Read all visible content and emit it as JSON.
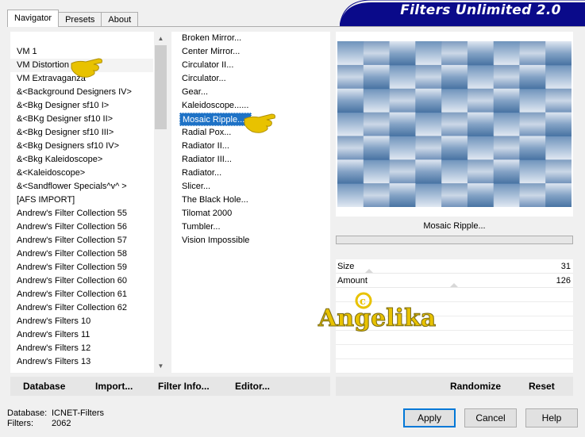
{
  "tabs": [
    "Navigator",
    "Presets",
    "About"
  ],
  "app_title": "Filters Unlimited 2.0",
  "categories": [
    "VM 1",
    "VM Distortion",
    "VM Extravaganza",
    "&<Background Designers IV>",
    "&<Bkg Designer sf10 I>",
    "&<BKg Designer sf10 II>",
    "&<Bkg Designer sf10 III>",
    "&<Bkg Designers sf10 IV>",
    "&<Bkg Kaleidoscope>",
    "&<Kaleidoscope>",
    "&<Sandflower Specials^v^ >",
    "[AFS IMPORT]",
    "Andrew's Filter Collection 55",
    "Andrew's Filter Collection 56",
    "Andrew's Filter Collection 57",
    "Andrew's Filter Collection 58",
    "Andrew's Filter Collection 59",
    "Andrew's Filter Collection 60",
    "Andrew's Filter Collection 61",
    "Andrew's Filter Collection 62",
    "Andrew's Filters 10",
    "Andrew's Filters 11",
    "Andrew's Filters 12",
    "Andrew's Filters 13"
  ],
  "selected_category": "VM Distortion",
  "filters": [
    "Broken Mirror...",
    "Center Mirror...",
    "Circulator II...",
    "Circulator...",
    "Gear...",
    "Kaleidoscope......",
    "Mosaic Ripple...",
    "Radial Pox...",
    "Radiator II...",
    "Radiator III...",
    "Radiator...",
    "Slicer...",
    "The Black Hole...",
    "Tilomat 2000",
    "Tumbler...",
    "Vision Impossible"
  ],
  "selected_filter": "Mosaic Ripple...",
  "preview_filter_name": "Mosaic Ripple...",
  "params": [
    {
      "label": "Size",
      "value": "31",
      "level": 0.12
    },
    {
      "label": "Amount",
      "value": "126",
      "level": 0.49
    }
  ],
  "watermark": "Angelika",
  "bottom_left_buttons": [
    "Database",
    "Import...",
    "Filter Info...",
    "Editor..."
  ],
  "bottom_right_buttons": [
    "Randomize",
    "Reset"
  ],
  "footer": {
    "database_label": "Database:",
    "database_value": "ICNET-Filters",
    "filters_label": "Filters:",
    "filters_value": "2062"
  },
  "dialog_buttons": {
    "apply": "Apply",
    "cancel": "Cancel",
    "help": "Help"
  },
  "colors": {
    "banner": "#0a0a8a",
    "selection": "#1e72c6",
    "accent": "#0078d7",
    "watermark": "#e8c200"
  }
}
